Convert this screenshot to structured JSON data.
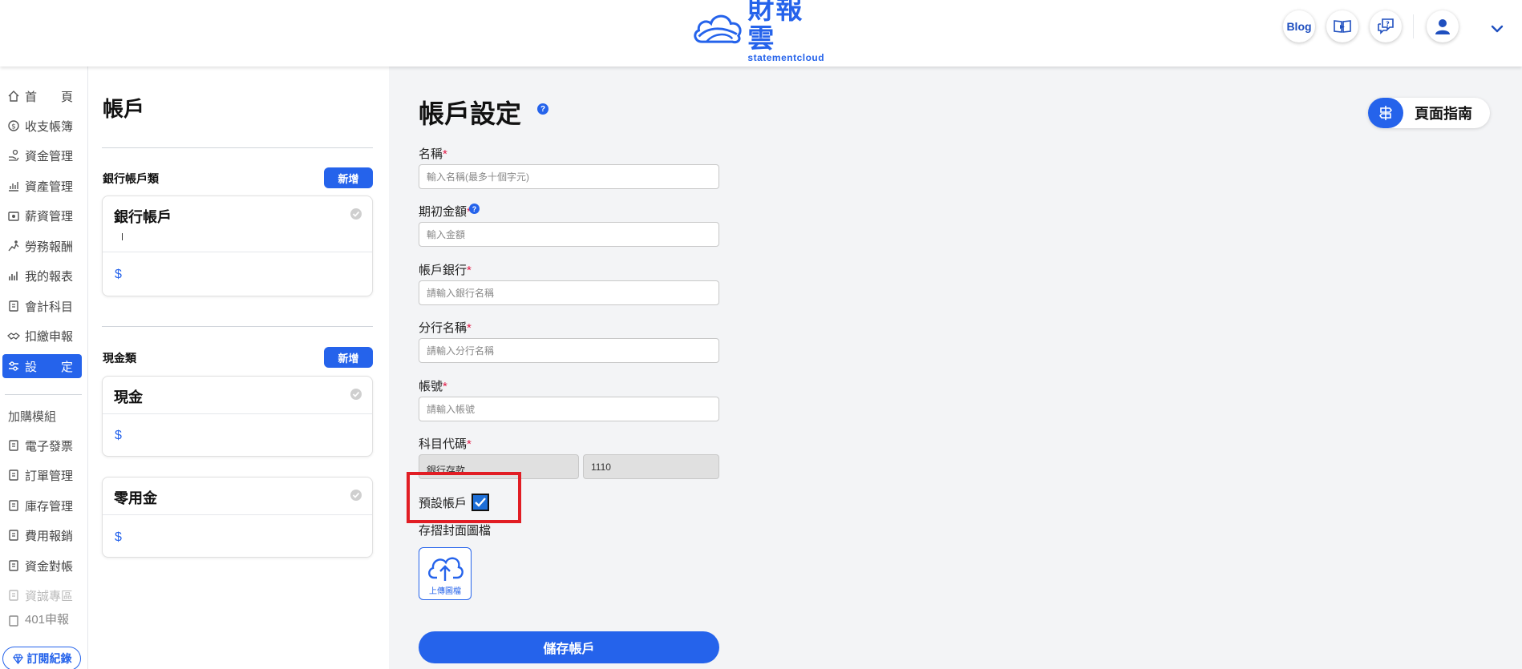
{
  "header": {
    "logo_cn": "財報雲",
    "logo_en": "statementcloud",
    "blog_label": "Blog",
    "icons": [
      "video-book-icon",
      "help-chat-icon",
      "user-avatar-icon",
      "chevron-down-icon"
    ]
  },
  "sidebar": {
    "items": [
      {
        "label": "首　　頁",
        "icon": "home-icon"
      },
      {
        "label": "收支帳簿",
        "icon": "dollar-circle-icon"
      },
      {
        "label": "資金管理",
        "icon": "money-hand-icon"
      },
      {
        "label": "資產管理",
        "icon": "asset-chart-icon"
      },
      {
        "label": "薪資管理",
        "icon": "salary-icon"
      },
      {
        "label": "勞務報酬",
        "icon": "service-icon"
      },
      {
        "label": "我的報表",
        "icon": "report-chart-icon"
      },
      {
        "label": "會計科目",
        "icon": "ledger-icon"
      },
      {
        "label": "扣繳申報",
        "icon": "handshake-icon"
      },
      {
        "label": "設　　定",
        "icon": "settings-sliders-icon"
      }
    ],
    "module_title": "加購模組",
    "modules": [
      {
        "label": "電子發票"
      },
      {
        "label": "訂單管理"
      },
      {
        "label": "庫存管理"
      },
      {
        "label": "費用報銷"
      },
      {
        "label": "資金對帳"
      },
      {
        "label": "資誠專區"
      },
      {
        "label": "401申報"
      }
    ],
    "subscribe_label": "訂閱紀錄"
  },
  "accounts": {
    "title": "帳戶",
    "bank_group": {
      "title": "銀行帳戶類",
      "add_label": "新增",
      "cards": [
        {
          "name": "銀行帳戶",
          "amount": "$"
        }
      ]
    },
    "cash_group": {
      "title": "現金類",
      "add_label": "新增",
      "cards": [
        {
          "name": "現金",
          "amount": "$"
        },
        {
          "name": "零用金",
          "amount": "$"
        }
      ]
    }
  },
  "form": {
    "title": "帳戶設定",
    "help_mark": "?",
    "guide_label": "頁面指南",
    "fields": {
      "name": {
        "label": "名稱",
        "required": "*",
        "placeholder": "輸入名稱(最多十個字元)"
      },
      "opening": {
        "label": "期初金額",
        "required": "*",
        "placeholder": "輸入金額"
      },
      "bank": {
        "label": "帳戶銀行",
        "required": "*",
        "placeholder": "請輸入銀行名稱"
      },
      "branch": {
        "label": "分行名稱",
        "required": "*",
        "placeholder": "請輸入分行名稱"
      },
      "account_no": {
        "label": "帳號",
        "required": "*",
        "placeholder": "請輸入帳號"
      },
      "subject": {
        "label": "科目代碼",
        "required": "*",
        "name_value": "銀行存款",
        "code_value": "1110"
      }
    },
    "default_label": "預設帳戶",
    "default_checked": true,
    "cover_label": "存摺封面圖檔",
    "upload_label": "上傳圖檔",
    "save_label": "儲存帳戶"
  }
}
